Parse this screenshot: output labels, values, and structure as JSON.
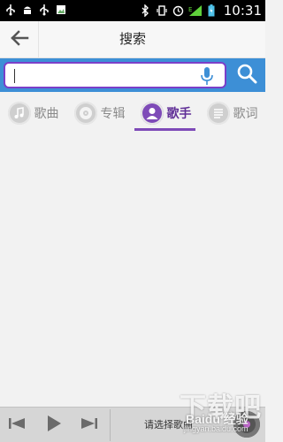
{
  "status_bar": {
    "time": "10:31",
    "network_label": "E",
    "icons": [
      "usb-icon",
      "android-debug-icon",
      "usb-icon",
      "image-icon",
      "bluetooth-icon",
      "vibrate-icon",
      "alarm-icon",
      "signal-icon",
      "battery-icon"
    ]
  },
  "header": {
    "title": "搜索",
    "back_icon": "arrow-left-icon"
  },
  "search": {
    "value": "",
    "placeholder": "",
    "mic_icon": "microphone-icon",
    "button_icon": "search-icon"
  },
  "tabs": [
    {
      "label": "歌曲",
      "icon": "music-note-icon",
      "active": false
    },
    {
      "label": "专辑",
      "icon": "disc-icon",
      "active": false
    },
    {
      "label": "歌手",
      "icon": "person-icon",
      "active": true
    },
    {
      "label": "歌词",
      "icon": "lyrics-icon",
      "active": false
    }
  ],
  "player": {
    "prompt": "请选择歌曲",
    "prev_icon": "skip-previous-icon",
    "play_icon": "play-icon",
    "next_icon": "skip-next-icon",
    "disc_icon": "album-disc-icon"
  },
  "watermark": {
    "big": "下载吧",
    "mid": "Baidu 经验",
    "small": "jingyan.baidu.com"
  },
  "colors": {
    "accent": "#7e4ab8",
    "search_bar": "#3d8fd6",
    "status_bar": "#000000"
  }
}
